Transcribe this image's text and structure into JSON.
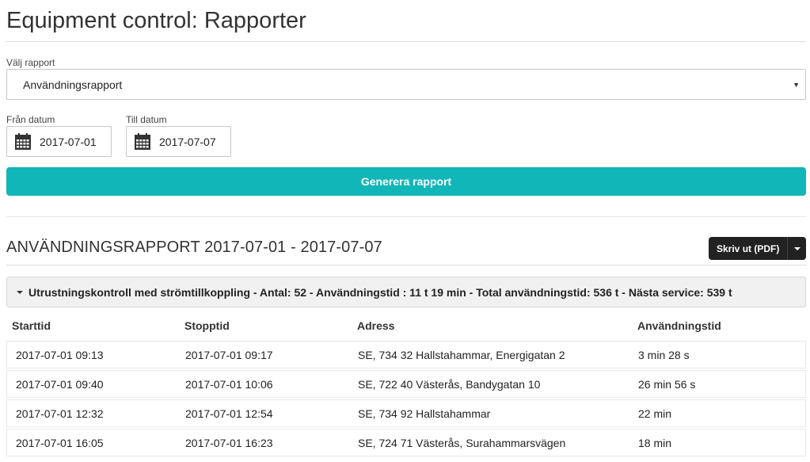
{
  "page": {
    "title": "Equipment control: Rapporter"
  },
  "report_select": {
    "label": "Välj rapport",
    "value": "Användningsrapport"
  },
  "from_date": {
    "label": "Från datum",
    "value": "2017-07-01"
  },
  "to_date": {
    "label": "Till datum",
    "value": "2017-07-07"
  },
  "generate_label": "Generera rapport",
  "report": {
    "heading": "ANVÄNDNINGSRAPPORT 2017-07-01 - 2017-07-07",
    "print_label": "Skriv ut (PDF)",
    "group_summary": "Utrustningskontroll med strömtillkoppling - Antal: 52 - Användningstid : 11 t 19 min - Total användningstid: 536 t - Nästa service: 539 t",
    "columns": [
      "Starttid",
      "Stopptid",
      "Adress",
      "Användningstid"
    ],
    "rows": [
      [
        "2017-07-01 09:13",
        "2017-07-01 09:17",
        "SE, 734 32 Hallstahammar, Energigatan 2",
        "3 min 28 s"
      ],
      [
        "2017-07-01 09:40",
        "2017-07-01 10:06",
        "SE, 722 40 Västerås, Bandygatan 10",
        "26 min 56 s"
      ],
      [
        "2017-07-01 12:32",
        "2017-07-01 12:54",
        "SE, 734 92 Hallstahammar",
        "22 min"
      ],
      [
        "2017-07-01 16:05",
        "2017-07-01 16:23",
        "SE, 724 71 Västerås, Surahammarsvägen",
        "18 min"
      ]
    ]
  },
  "colors": {
    "accent": "#11b6b8",
    "dark_button": "#222222"
  },
  "icons": {
    "date": "calendar-icon",
    "select": "caret-down-icon",
    "group": "triangle-down-icon"
  }
}
